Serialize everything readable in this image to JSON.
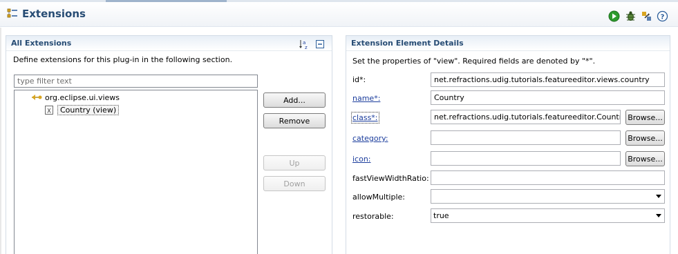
{
  "header": {
    "title": "Extensions",
    "actions": [
      "run-icon",
      "debug-icon",
      "export-icon",
      "help-icon"
    ]
  },
  "all_extensions": {
    "title": "All Extensions",
    "description": "Define extensions for this plug-in in the following section.",
    "filter_placeholder": "type filter text",
    "toolbar_icons": [
      "sort-icon",
      "collapse-all-icon"
    ],
    "tree": [
      {
        "label": "org.eclipse.ui.views",
        "icon": "extension-point-icon"
      },
      {
        "label": "Country (view)",
        "icon": "element-icon",
        "selected": true
      }
    ],
    "buttons": {
      "add": "Add...",
      "remove": "Remove",
      "up": "Up",
      "down": "Down"
    }
  },
  "details": {
    "title": "Extension Element Details",
    "description": "Set the properties of \"view\". Required fields are denoted by \"*\".",
    "browse_label": "Browse...",
    "fields": {
      "id": {
        "label": "id*:",
        "value": "net.refractions.udig.tutorials.featureeditor.views.country"
      },
      "name": {
        "label": "name*:",
        "value": "Country"
      },
      "class": {
        "label": "class*:",
        "value": "net.refractions.udig.tutorials.featureeditor.Country"
      },
      "category": {
        "label": "category:",
        "value": ""
      },
      "icon": {
        "label": "icon:",
        "value": ""
      },
      "fastViewWidthRatio": {
        "label": "fastViewWidthRatio:",
        "value": ""
      },
      "allowMultiple": {
        "label": "allowMultiple:",
        "value": ""
      },
      "restorable": {
        "label": "restorable:",
        "value": "true"
      }
    }
  }
}
